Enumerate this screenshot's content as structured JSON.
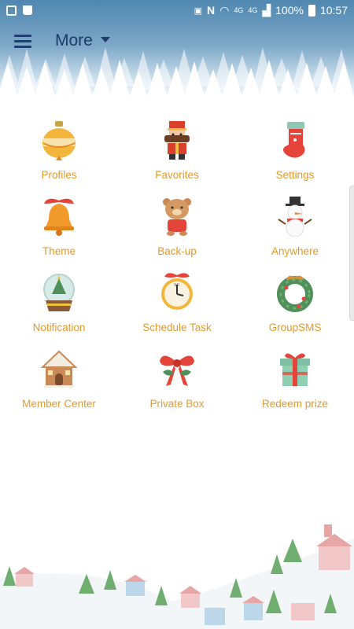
{
  "status_bar": {
    "network_small_1": "4G",
    "network_small_2": "4G",
    "battery_percent": "100%",
    "time": "10:57"
  },
  "header": {
    "title": "More"
  },
  "grid": [
    {
      "label": "Profiles",
      "icon": "ornament-icon"
    },
    {
      "label": "Favorites",
      "icon": "nutcracker-icon"
    },
    {
      "label": "Settings",
      "icon": "stocking-icon"
    },
    {
      "label": "Theme",
      "icon": "bell-icon"
    },
    {
      "label": "Back-up",
      "icon": "bear-icon"
    },
    {
      "label": "Anywhere",
      "icon": "snowman-icon"
    },
    {
      "label": "Notification",
      "icon": "snowglobe-icon"
    },
    {
      "label": "Schedule Task",
      "icon": "clock-icon"
    },
    {
      "label": "GroupSMS",
      "icon": "wreath-icon"
    },
    {
      "label": "Member Center",
      "icon": "gingerbread-house-icon"
    },
    {
      "label": "Private Box",
      "icon": "bow-icon"
    },
    {
      "label": "Redeem prize",
      "icon": "gift-box-icon"
    }
  ],
  "colors": {
    "label": "#e39a2c",
    "title": "#1d3b6a",
    "sky": "#4f87b0"
  }
}
